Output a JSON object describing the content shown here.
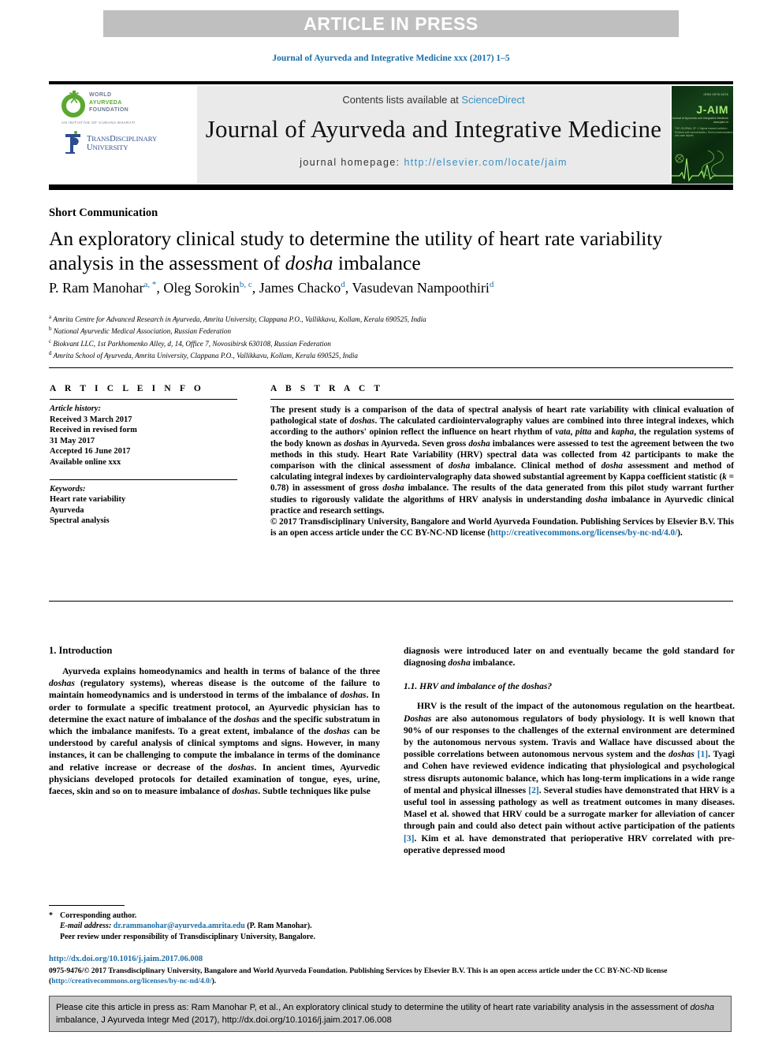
{
  "banner": {
    "text": "ARTICLE IN PRESS"
  },
  "running_head": "Journal of Ayurveda and Integrative Medicine xxx (2017) 1–5",
  "masthead": {
    "contents_prefix": "Contents lists available at ",
    "contents_link": "ScienceDirect",
    "journal_title": "Journal of Ayurveda and Integrative Medicine",
    "homepage_label": "journal homepage: ",
    "homepage_url": "http://elsevier.com/locate/jaim",
    "logos": {
      "wa_line1": "WORLD",
      "wa_line2": "AYURVEDA",
      "wa_line3": "FOUNDATION",
      "wa_tagline": "AN INITIATIVE OF VIJNANA BHARATI",
      "td_line1": "TʀᴀɴsDisciplinary",
      "td_line2": "University",
      "cover_title": "J-AIM",
      "cover_top": "ISSN 0975-9476",
      "cover_sub": "Journal of Ayurveda and Integrative Medicine\nwww.jaim.in",
      "cover_left": "THE JOURNAL OF\n• Original research articles\n• Reviews and commentaries\n• Short communications and case reports"
    }
  },
  "article": {
    "type_label": "Short Communication",
    "title_part1": "An exploratory clinical study to determine the utility of heart rate variability analysis in the assessment of ",
    "title_italic": "dosha",
    "title_part2": " imbalance",
    "authors": [
      {
        "name": "P. Ram Manohar",
        "sup": "a, *"
      },
      {
        "name": "Oleg Sorokin",
        "sup": "b, c"
      },
      {
        "name": "James Chacko",
        "sup": "d"
      },
      {
        "name": "Vasudevan Nampoothiri",
        "sup": "d"
      }
    ],
    "affiliations": [
      {
        "mark": "a",
        "text": "Amrita Centre for Advanced Research in Ayurveda, Amrita University, Clappana P.O., Vallikkavu, Kollam, Kerala 690525, India"
      },
      {
        "mark": "b",
        "text": "National Ayurvedic Medical Association, Russian Federation"
      },
      {
        "mark": "c",
        "text": "Biokvant LLC, 1st Parkhomenko Alley, d, 14, Office 7, Novosibirsk 630108, Russian Federation"
      },
      {
        "mark": "d",
        "text": "Amrita School of Ayurveda, Amrita University, Clappana P.O., Vallikkavu, Kollam, Kerala 690525, India"
      }
    ]
  },
  "article_info": {
    "heading": "A R T I C L E  I N F O",
    "history_label": "Article history:",
    "history": [
      "Received 3 March 2017",
      "Received in revised form",
      "31 May 2017",
      "Accepted 16 June 2017",
      "Available online xxx"
    ],
    "keywords_label": "Keywords:",
    "keywords": [
      "Heart rate variability",
      "Ayurveda",
      "Spectral analysis"
    ]
  },
  "abstract": {
    "heading": "A B S T R A C T",
    "paragraph": "The present study is a comparison of the data of spectral analysis of heart rate variability with clinical evaluation of pathological state of doshas. The calculated cardiointervalography values are combined into three integral indexes, which according to the authors' opinion reflect the influence on heart rhythm of vata, pitta and kapha, the regulation systems of the body known as doshas in Ayurveda. Seven gross dosha imbalances were assessed to test the agreement between the two methods in this study. Heart Rate Variability (HRV) spectral data was collected from 42 participants to make the comparison with the clinical assessment of dosha imbalance. Clinical method of dosha assessment and method of calculating integral indexes by cardiointervalography data showed substantial agreement by Kappa coefficient statistic (k = 0.78) in assessment of gross dosha imbalance. The results of the data generated from this pilot study warrant further studies to rigorously validate the algorithms of HRV analysis in understanding dosha imbalance in Ayurvedic clinical practice and research settings.",
    "copyright": "© 2017 Transdisciplinary University, Bangalore and World Ayurveda Foundation. Publishing Services by Elsevier B.V. This is an open access article under the CC BY-NC-ND license (",
    "license_url": "http://creativecommons.org/licenses/by-nc-nd/4.0/",
    "copyright_tail": ")."
  },
  "body": {
    "left": {
      "section_heading": "1. Introduction",
      "paragraph": "Ayurveda explains homeodynamics and health in terms of balance of the three doshas (regulatory systems), whereas disease is the outcome of the failure to maintain homeodynamics and is understood in terms of the imbalance of doshas. In order to formulate a specific treatment protocol, an Ayurvedic physician has to determine the exact nature of imbalance of the doshas and the specific substratum in which the imbalance manifests. To a great extent, imbalance of the doshas can be understood by careful analysis of clinical symptoms and signs. However, in many instances, it can be challenging to compute the imbalance in terms of the dominance and relative increase or decrease of the doshas. In ancient times, Ayurvedic physicians developed protocols for detailed examination of tongue, eyes, urine, faeces, skin and so on to measure imbalance of doshas. Subtle techniques like pulse"
    },
    "right": {
      "continuation": "diagnosis were introduced later on and eventually became the gold standard for diagnosing dosha imbalance.",
      "subsection_heading": "1.1. HRV and imbalance of the doshas?",
      "paragraph": "HRV is the result of the impact of the autonomous regulation on the heartbeat. Doshas are also autonomous regulators of body physiology. It is well known that 90% of our responses to the challenges of the external environment are determined by the autonomous nervous system. Travis and Wallace have discussed about the possible correlations between autonomous nervous system and the doshas [1]. Tyagi and Cohen have reviewed evidence indicating that physiological and psychological stress disrupts autonomic balance, which has long-term implications in a wide range of mental and physical illnesses [2]. Several studies have demonstrated that HRV is a useful tool in assessing pathology as well as treatment outcomes in many diseases. Masel et al. showed that HRV could be a surrogate marker for alleviation of cancer through pain and could also detect pain without active participation of the patients [3]. Kim et al. have demonstrated that perioperative HRV correlated with pre-operative depressed mood"
    }
  },
  "footnotes": {
    "corresponding": "Corresponding author.",
    "email_label": "E-mail address:",
    "email": "dr.rammanohar@ayurveda.amrita.edu",
    "email_suffix": "(P. Ram Manohar).",
    "peer_review": "Peer review under responsibility of Transdisciplinary University, Bangalore."
  },
  "footer": {
    "doi": "http://dx.doi.org/10.1016/j.jaim.2017.06.008",
    "issn_prefix": "0975-9476/© 2017 Transdisciplinary University, Bangalore and World Ayurveda Foundation. Publishing Services by Elsevier B.V. This is an open access article under the CC BY-NC-ND license (",
    "issn_link": "http://creativecommons.org/licenses/by-nc-nd/4.0/",
    "issn_suffix": ")."
  },
  "cite_box": {
    "prefix": "Please cite this article in press as: Ram Manohar P, et al., An exploratory clinical study to determine the utility of heart rate variability analysis in the assessment of ",
    "italic": "dosha",
    "suffix": " imbalance, J Ayurveda Integr Med (2017), http://dx.doi.org/10.1016/j.jaim.2017.06.008"
  },
  "colors": {
    "link": "#1a6ea8",
    "banner_bg": "#bfbfbf",
    "masthead_bg": "#eaeaea",
    "cite_bg": "#c9c9c9"
  }
}
